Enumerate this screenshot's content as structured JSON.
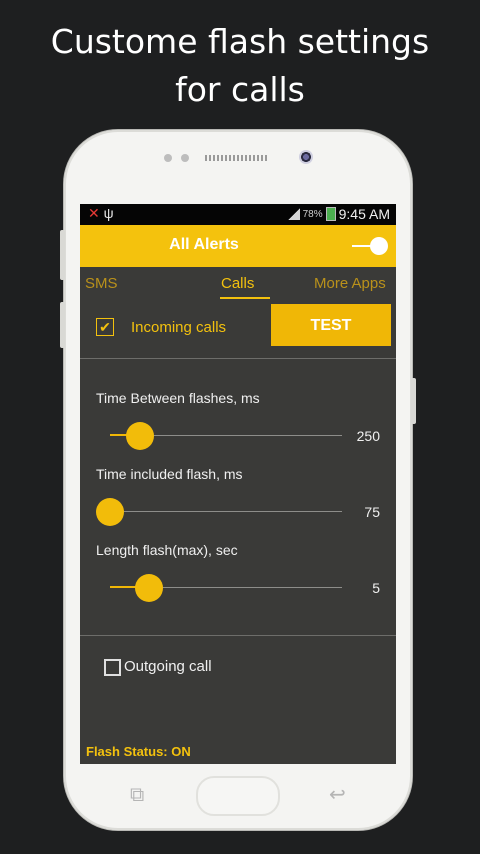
{
  "promo": {
    "line1": "Custome flash settings",
    "line2": "for calls"
  },
  "status_bar": {
    "battery_percent": "78%",
    "time": "9:45 AM"
  },
  "app_bar": {
    "title": "All Alerts",
    "master_toggle_on": true
  },
  "tabs": [
    {
      "label": "SMS",
      "active": false
    },
    {
      "label": "Calls",
      "active": true
    },
    {
      "label": "More Apps",
      "active": false
    }
  ],
  "incoming": {
    "label": "Incoming calls",
    "checked": true,
    "test_button": "TEST"
  },
  "sliders": [
    {
      "label": "Time Between flashes, ms",
      "value": "250",
      "fraction": 0.13
    },
    {
      "label": "Time included flash, ms",
      "value": "75",
      "fraction": 0.0
    },
    {
      "label": "Length flash(max), sec",
      "value": "5",
      "fraction": 0.17
    }
  ],
  "outgoing": {
    "label": "Outgoing call",
    "checked": false
  },
  "flash_status": "Flash Status: ON",
  "colors": {
    "accent": "#f4c20d",
    "screen_bg": "#3a3a38",
    "background": "#1e1f20"
  }
}
